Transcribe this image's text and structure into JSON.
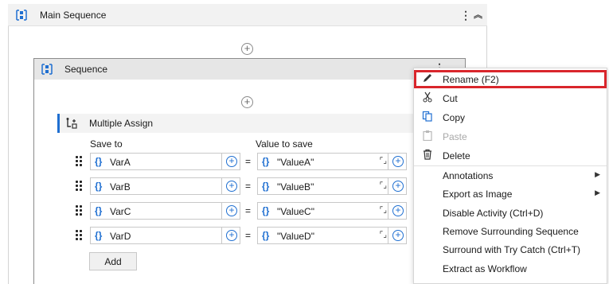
{
  "main_sequence": {
    "title": "Main Sequence"
  },
  "sequence": {
    "title": "Sequence"
  },
  "multiple_assign": {
    "title": "Multiple Assign",
    "col_save_to": "Save to",
    "col_value_to_save": "Value to save",
    "rows": [
      {
        "variable": "VarA",
        "value": "\"ValueA\""
      },
      {
        "variable": "VarB",
        "value": "\"ValueB\""
      },
      {
        "variable": "VarC",
        "value": "\"ValueC\""
      },
      {
        "variable": "VarD",
        "value": "\"ValueD\""
      }
    ],
    "equals": "=",
    "brace": "{}",
    "add_label": "Add"
  },
  "context_menu": {
    "items": [
      {
        "label": "Rename (F2)",
        "icon": "pencil-icon",
        "enabled": true,
        "highlighted": true
      },
      {
        "label": "Cut",
        "icon": "scissors-icon",
        "enabled": true
      },
      {
        "label": "Copy",
        "icon": "copy-icon",
        "enabled": true
      },
      {
        "label": "Paste",
        "icon": "clipboard-icon",
        "enabled": false
      },
      {
        "label": "Delete",
        "icon": "trash-icon",
        "enabled": true
      },
      {
        "label": "Annotations",
        "submenu": true
      },
      {
        "label": "Export as Image",
        "submenu": true
      },
      {
        "label": "Disable Activity (Ctrl+D)"
      },
      {
        "label": "Remove Surrounding Sequence"
      },
      {
        "label": "Surround with Try Catch (Ctrl+T)"
      },
      {
        "label": "Extract as Workflow"
      }
    ]
  },
  "colors": {
    "accent": "#1f6fd1",
    "highlight_border": "#d9262c"
  }
}
